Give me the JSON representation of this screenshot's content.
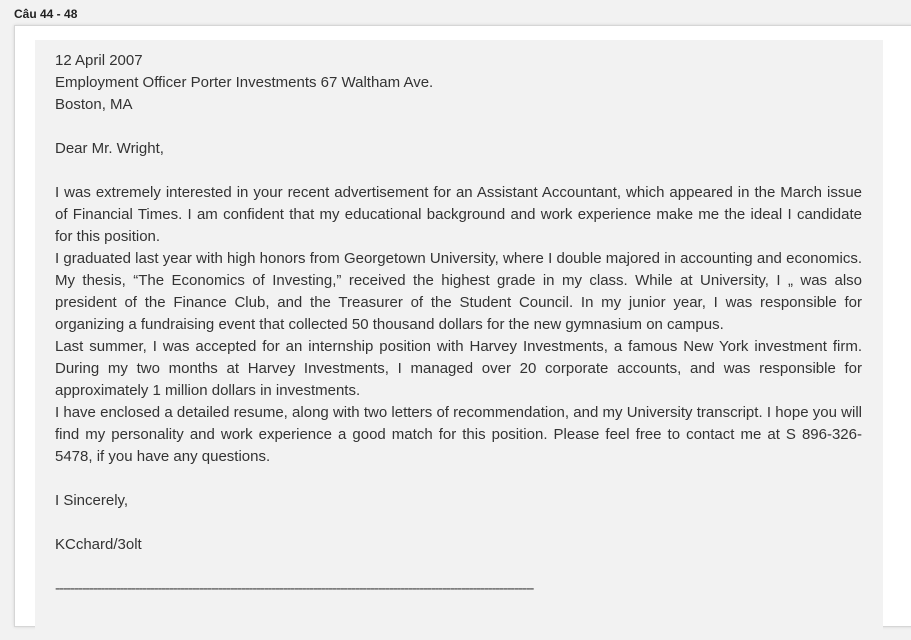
{
  "header": {
    "label": "Câu 44 - 48"
  },
  "letter": {
    "date": "12 April 2007",
    "address_line1": "Employment Officer Porter Investments 67 Waltham Ave.",
    "address_line2": "Boston, MA",
    "salutation": "Dear Mr. Wright,",
    "paragraphs": [
      "I was extremely interested in your recent advertisement for an Assistant Accountant, which appeared in the March issue of Financial Times. I am confident that my educational background and work experience make me the ideal I candidate for this position.",
      "I graduated last year with high honors from Georgetown University, where I double majored in accounting and economics. My thesis, “The Economics of Investing,” received the highest grade in my class. While at University, I „ was also president of the Finance Club, and the Treasurer of the Student Council. In my junior year, I was responsible for organizing a fundraising event that collected 50 thousand dollars for the new gymnasium on campus.",
      "Last summer, I was accepted for an internship position with Harvey Investments, a famous New York investment firm. During my two months at Harvey Investments, I managed over 20 corporate accounts, and was responsible for approximately 1 million dollars in investments.",
      "I have enclosed a detailed resume, along with two letters of recommendation, and my University transcript. I hope you will find my personality and work experience a good match for this position. Please feel free to contact me at S 896-326-5478, if you have any questions."
    ],
    "closing": "I Sincerely,",
    "signature": "KCchard/3olt",
    "divider": "------------------------------------------------------------------------------------------------------------------------------"
  }
}
